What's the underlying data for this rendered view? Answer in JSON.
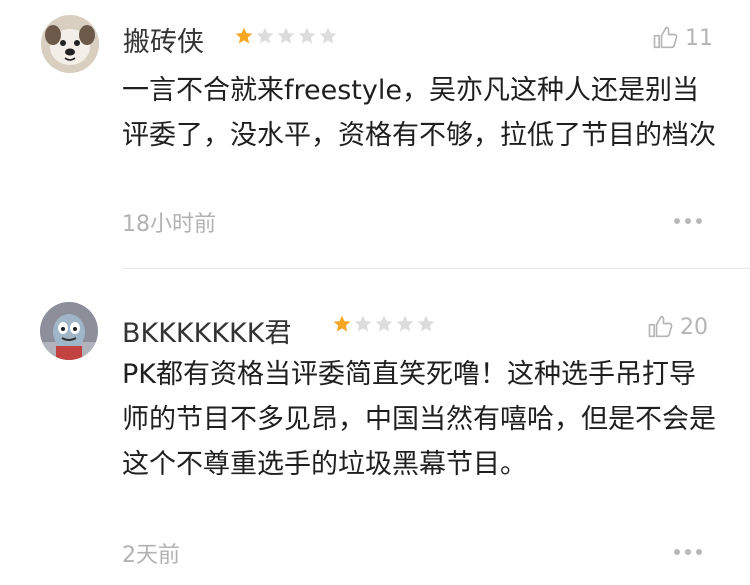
{
  "comments": [
    {
      "username": "搬砖侠",
      "rating": 1,
      "likes": "11",
      "text": "一言不合就来freestyle，吴亦凡这种人还是别当评委了，没水平，资格有不够，拉低了节目的档次",
      "time": "18小时前",
      "avatar_icon": "dog-avatar"
    },
    {
      "username": "BKKKKKKK君",
      "rating": 1,
      "likes": "20",
      "text": "PK都有资格当评委简直笑死噜！这种选手吊打导师的节目不多见昂，中国当然有嘻哈，但是不会是这个不尊重选手的垃圾黑幕节目。",
      "time": "2天前",
      "avatar_icon": "cartoon-bird-avatar"
    }
  ],
  "colors": {
    "star_active": "#f5a623",
    "star_inactive": "#dcdcdc",
    "meta": "#b5b5b5"
  }
}
